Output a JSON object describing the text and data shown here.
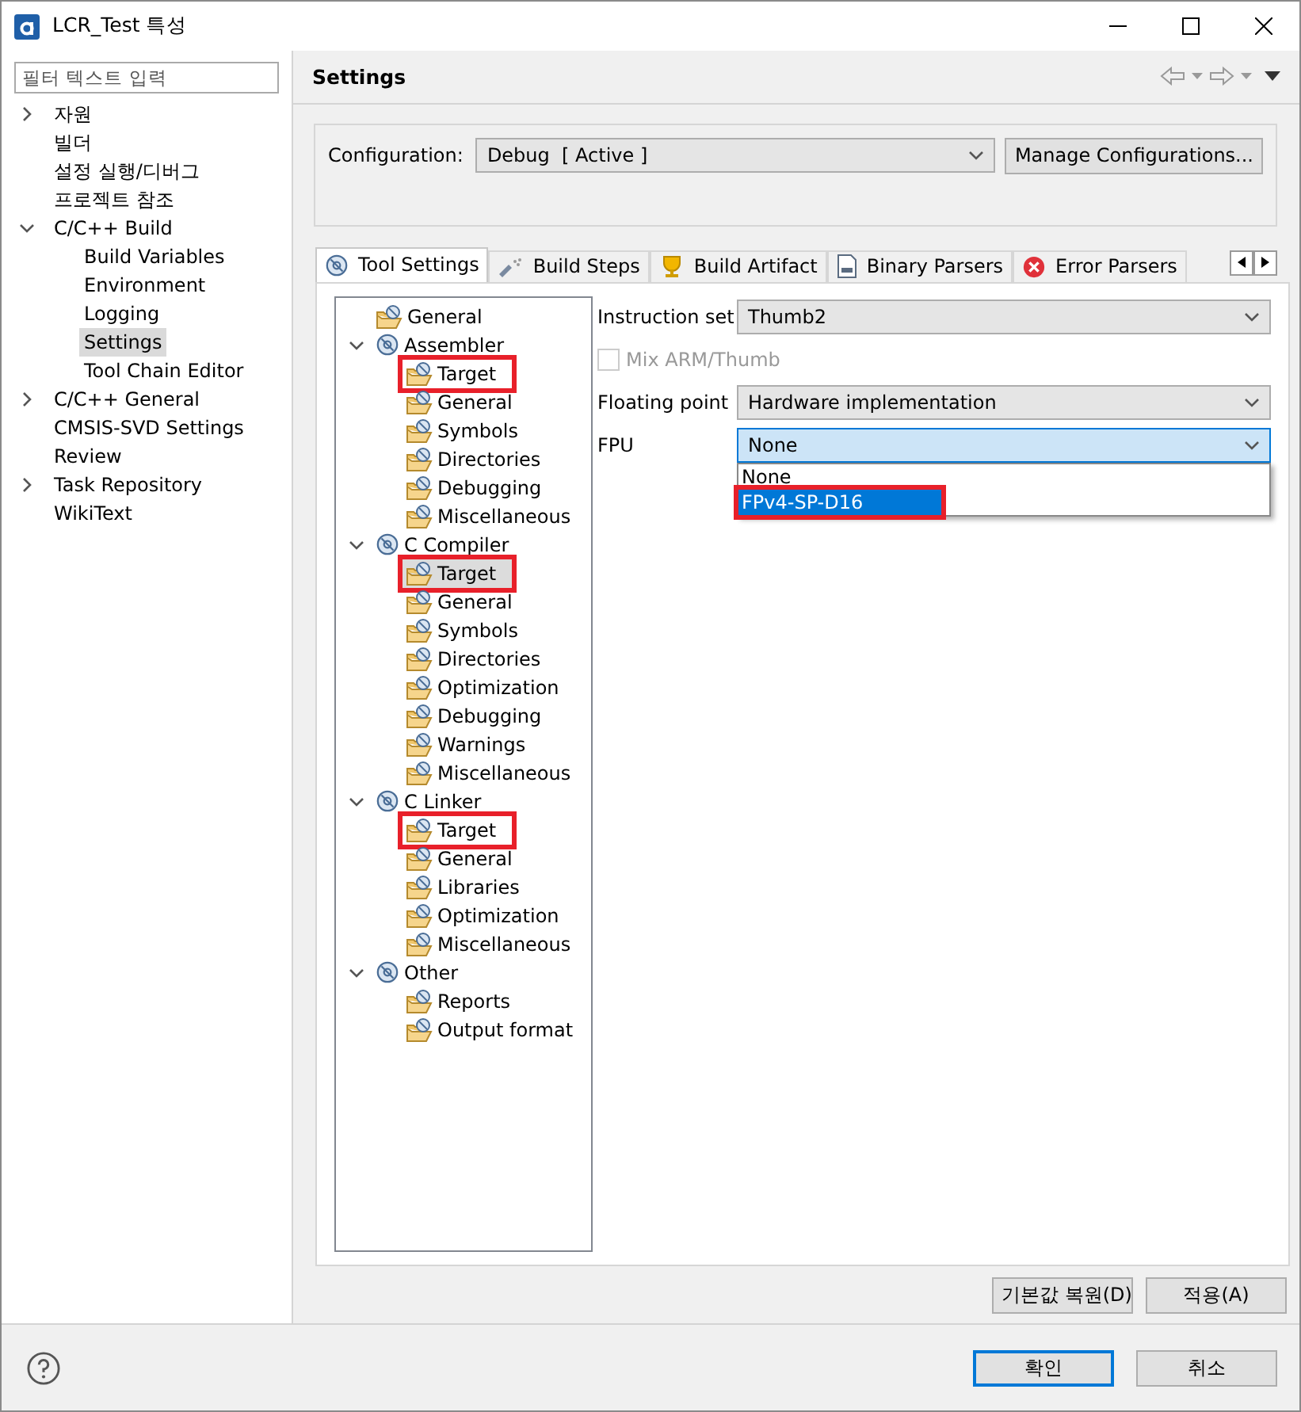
{
  "window": {
    "title": "LCR_Test 특성"
  },
  "filter": {
    "placeholder": "필터 텍스트 입력"
  },
  "nav": [
    {
      "label": "자원",
      "expanded": false,
      "selected": false
    },
    {
      "label": "빌더",
      "selected": false
    },
    {
      "label": "설정 실행/디버그",
      "selected": false
    },
    {
      "label": "프로젝트 참조",
      "selected": false
    },
    {
      "label": "C/C++ Build",
      "expanded": true,
      "selected": false,
      "children": [
        {
          "label": "Build Variables",
          "selected": false
        },
        {
          "label": "Environment",
          "selected": false
        },
        {
          "label": "Logging",
          "selected": false
        },
        {
          "label": "Settings",
          "selected": true
        },
        {
          "label": "Tool Chain Editor",
          "selected": false
        }
      ]
    },
    {
      "label": "C/C++ General",
      "expanded": false,
      "selected": false
    },
    {
      "label": "CMSIS-SVD Settings",
      "selected": false
    },
    {
      "label": "Review",
      "selected": false
    },
    {
      "label": "Task Repository",
      "expanded": false,
      "selected": false
    },
    {
      "label": "WikiText",
      "selected": false
    }
  ],
  "page": {
    "title": "Settings"
  },
  "configuration": {
    "label": "Configuration:",
    "value": "Debug  [ Active ]",
    "button": "Manage Configurations..."
  },
  "tabs": [
    {
      "label": "Tool Settings",
      "kind": "gear",
      "selected": true
    },
    {
      "label": "Build Steps",
      "kind": "steps",
      "selected": false
    },
    {
      "label": "Build Artifact",
      "kind": "trophy",
      "selected": false
    },
    {
      "label": "Binary Parsers",
      "kind": "binary",
      "selected": false
    },
    {
      "label": "Error Parsers",
      "kind": "error",
      "selected": false
    }
  ],
  "tool_tree": [
    {
      "label": "General",
      "kind": "page",
      "selected": false,
      "marked": false
    },
    {
      "label": "Assembler",
      "kind": "tool",
      "expanded": true,
      "marked": false,
      "selected": false,
      "children": [
        {
          "label": "Target",
          "kind": "page",
          "selected": false,
          "marked": true
        },
        {
          "label": "General",
          "kind": "page",
          "selected": false,
          "marked": false
        },
        {
          "label": "Symbols",
          "kind": "page",
          "selected": false,
          "marked": false
        },
        {
          "label": "Directories",
          "kind": "page",
          "selected": false,
          "marked": false
        },
        {
          "label": "Debugging",
          "kind": "page",
          "selected": false,
          "marked": false
        },
        {
          "label": "Miscellaneous",
          "kind": "page",
          "selected": false,
          "marked": false
        }
      ]
    },
    {
      "label": "C Compiler",
      "kind": "tool",
      "expanded": true,
      "marked": false,
      "selected": false,
      "children": [
        {
          "label": "Target",
          "kind": "page",
          "selected": true,
          "marked": true
        },
        {
          "label": "General",
          "kind": "page",
          "selected": false,
          "marked": false
        },
        {
          "label": "Symbols",
          "kind": "page",
          "selected": false,
          "marked": false
        },
        {
          "label": "Directories",
          "kind": "page",
          "selected": false,
          "marked": false
        },
        {
          "label": "Optimization",
          "kind": "page",
          "selected": false,
          "marked": false
        },
        {
          "label": "Debugging",
          "kind": "page",
          "selected": false,
          "marked": false
        },
        {
          "label": "Warnings",
          "kind": "page",
          "selected": false,
          "marked": false
        },
        {
          "label": "Miscellaneous",
          "kind": "page",
          "selected": false,
          "marked": false
        }
      ]
    },
    {
      "label": "C Linker",
      "kind": "tool",
      "expanded": true,
      "marked": false,
      "selected": false,
      "children": [
        {
          "label": "Target",
          "kind": "page",
          "selected": false,
          "marked": true
        },
        {
          "label": "General",
          "kind": "page",
          "selected": false,
          "marked": false
        },
        {
          "label": "Libraries",
          "kind": "page",
          "selected": false,
          "marked": false
        },
        {
          "label": "Optimization",
          "kind": "page",
          "selected": false,
          "marked": false
        },
        {
          "label": "Miscellaneous",
          "kind": "page",
          "selected": false,
          "marked": false
        }
      ]
    },
    {
      "label": "Other",
      "kind": "tool",
      "expanded": true,
      "marked": false,
      "selected": false,
      "children": [
        {
          "label": "Reports",
          "kind": "page",
          "selected": false,
          "marked": false
        },
        {
          "label": "Output format",
          "kind": "page",
          "selected": false,
          "marked": false
        }
      ]
    }
  ],
  "options": [
    {
      "kind": "select",
      "label": "Instruction set",
      "value": "Thumb2",
      "focused": false
    },
    {
      "kind": "checkbox",
      "label": "Mix ARM/Thumb",
      "checked": false,
      "disabled": true
    },
    {
      "kind": "select",
      "label": "Floating point",
      "value": "Hardware implementation",
      "focused": false
    },
    {
      "kind": "select",
      "label": "FPU",
      "value": "None",
      "focused": true,
      "open": true,
      "items": [
        {
          "label": "None",
          "highlighted": false,
          "marked": false
        },
        {
          "label": "FPv4-SP-D16",
          "highlighted": true,
          "marked": true
        }
      ]
    }
  ],
  "page_buttons": [
    "기본값 복원(D)",
    "적용(A)"
  ],
  "dialog_buttons": [
    {
      "label": "확인",
      "default": true
    },
    {
      "label": "취소",
      "default": false
    }
  ]
}
